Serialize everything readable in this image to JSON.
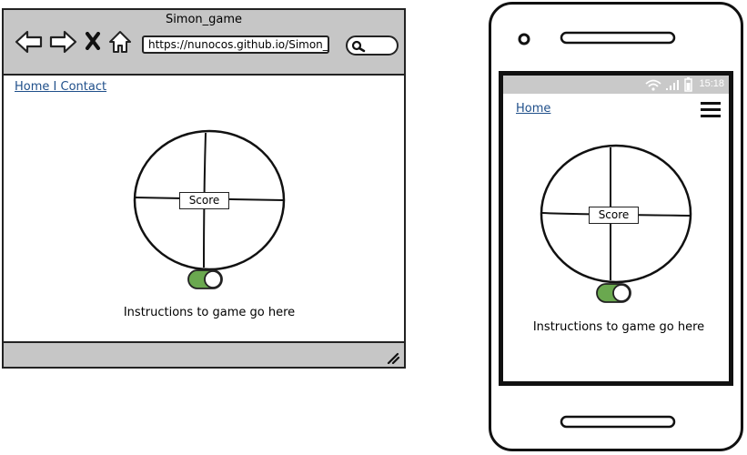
{
  "desktop": {
    "window_title": "Simon_game",
    "url": "https://nunocos.github.io/Simon_",
    "nav": {
      "home": "Home",
      "separator": " I ",
      "contact": "Contact"
    },
    "score_label": "Score",
    "instructions": "Instructions to game go here",
    "toggle_on": true
  },
  "mobile": {
    "status_time": "15:18",
    "nav_home": "Home",
    "score_label": "Score",
    "instructions": "Instructions to game go here",
    "toggle_on": true
  },
  "colors": {
    "toggle_green": "#6aa84f",
    "link_blue": "#1f4f8a",
    "chrome_gray": "#c6c6c6"
  },
  "icons": {
    "back": "back-arrow-icon",
    "forward": "forward-arrow-icon",
    "close": "close-icon",
    "home": "home-icon",
    "search": "search-icon",
    "resize": "resize-grip-icon",
    "wifi": "wifi-icon",
    "signal": "signal-icon",
    "battery": "battery-icon",
    "menu": "hamburger-menu-icon"
  }
}
